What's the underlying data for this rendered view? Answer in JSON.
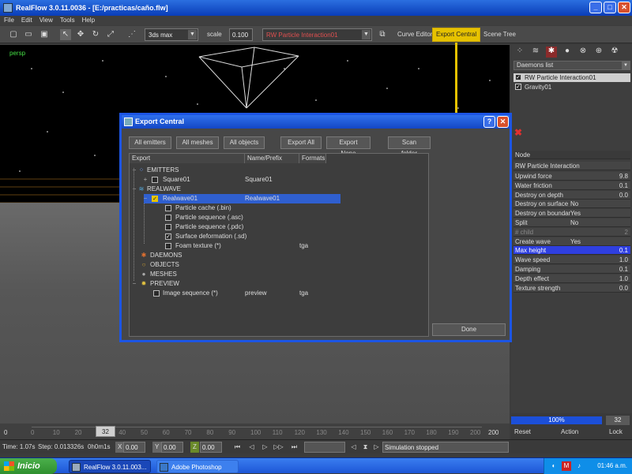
{
  "window": {
    "title": "RealFlow 3.0.11.0036 - [E:/practicas/caño.flw]"
  },
  "menu": [
    "File",
    "Edit",
    "View",
    "Tools",
    "Help"
  ],
  "toolbar": {
    "format_value": "3ds max",
    "scale_label": "scale",
    "scale_value": "0.100",
    "daemon_combo": "RW Particle Interaction01",
    "tabs": [
      "Curve Editor",
      "Export Central",
      "Scene Tree"
    ],
    "active_tab": "Export Central"
  },
  "viewport": {
    "label": "persp"
  },
  "right_panel": {
    "daemons_list_label": "Daemons list",
    "daemons": [
      {
        "name": "RW Particle Interaction01",
        "checked": true,
        "selected": true
      },
      {
        "name": "Gravity01",
        "checked": true,
        "selected": false
      }
    ],
    "node_label": "Node",
    "node_name": "RW Particle Interaction",
    "properties": [
      {
        "name": "Upwind force",
        "value": "9.8"
      },
      {
        "name": "Water friction",
        "value": "0.1"
      },
      {
        "name": "Destroy on depth",
        "value": "0.0"
      },
      {
        "name": "Destroy on surface",
        "value": "No"
      },
      {
        "name": "Destroy on boundar",
        "value": "Yes"
      },
      {
        "name": "Split",
        "value": "No"
      },
      {
        "name": "# child",
        "value": "2"
      },
      {
        "name": "Create wave",
        "value": "Yes"
      },
      {
        "name": "Max height",
        "value": "0.1"
      },
      {
        "name": "Wave speed",
        "value": "1.0"
      },
      {
        "name": "Damping",
        "value": "0.1"
      },
      {
        "name": "Depth effect",
        "value": "1.0"
      },
      {
        "name": "Texture strength",
        "value": "0.0"
      }
    ],
    "progress_percent": 100,
    "progress_label": "100%",
    "progress_value": "32",
    "reset_label": "Reset",
    "action_label": "Action",
    "lock_label": "Lock"
  },
  "timeline": {
    "start": "0",
    "current": "32",
    "end": "200",
    "ticks": [
      "0",
      "10",
      "20",
      "40",
      "50",
      "60",
      "70",
      "80",
      "90",
      "100",
      "110",
      "120",
      "130",
      "140",
      "150",
      "160",
      "170",
      "180",
      "190",
      "200"
    ]
  },
  "status": {
    "time": "Time: 1.07s",
    "step": "Step: 0.013326s",
    "clock": "0h0m1s",
    "x_label": "X",
    "x_value": "0.00",
    "y_label": "Y",
    "y_value": "0.00",
    "z_label": "Z",
    "z_value": "0.00",
    "message": "Simulation stopped"
  },
  "dialog": {
    "title": "Export Central",
    "buttons": [
      "All emitters",
      "All meshes",
      "All objects",
      "Export All",
      "Export None",
      "Scan folder"
    ],
    "columns": [
      "Export",
      "Name/Prefix",
      "Formats"
    ],
    "done_label": "Done",
    "rows": [
      {
        "label": "EMITTERS",
        "name": "",
        "format": ""
      },
      {
        "label": "Square01",
        "name": "Square01",
        "format": ""
      },
      {
        "label": "REALWAVE",
        "name": "",
        "format": ""
      },
      {
        "label": "Realwave01",
        "name": "Realwave01",
        "format": ""
      },
      {
        "label": "Particle cache (.bin)",
        "name": "",
        "format": ""
      },
      {
        "label": "Particle sequence (.asc)",
        "name": "",
        "format": ""
      },
      {
        "label": "Particle sequence (.pdc)",
        "name": "",
        "format": ""
      },
      {
        "label": "Surface deformation (.sd)",
        "name": "",
        "format": ""
      },
      {
        "label": "Foam texture (*)",
        "name": "",
        "format": "tga"
      },
      {
        "label": "DAEMONS",
        "name": "",
        "format": ""
      },
      {
        "label": "OBJECTS",
        "name": "",
        "format": ""
      },
      {
        "label": "MESHES",
        "name": "",
        "format": ""
      },
      {
        "label": "PREVIEW",
        "name": "",
        "format": ""
      },
      {
        "label": "Image sequence (*)",
        "name": "preview",
        "format": "tga"
      }
    ]
  },
  "taskbar": {
    "start_label": "Inicio",
    "tasks": [
      "RealFlow 3.0.11.003...",
      "Adobe Photoshop"
    ],
    "clock": "01:46 a.m."
  },
  "colors": {
    "accent": "#e6c200",
    "selection": "#2f5fcf",
    "titlebar": "#1c55e4"
  }
}
